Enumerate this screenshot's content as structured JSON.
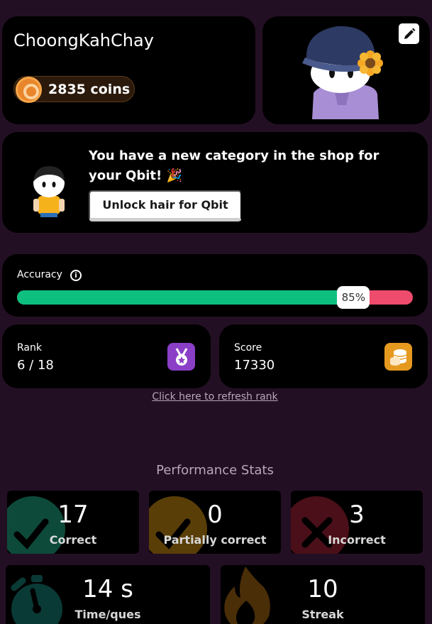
{
  "profile": {
    "username": "ChoongKahChay",
    "coins_text": "2835 coins"
  },
  "banner": {
    "message": "You have a new category in the shop for your Qbit! 🎉",
    "button_label": "Unlock hair for Qbit"
  },
  "accuracy": {
    "label": "Accuracy",
    "percent": 85,
    "percent_text": "85%",
    "colors": {
      "fill": "#0ec07f",
      "remainder": "#ef4b6c"
    }
  },
  "rank": {
    "label": "Rank",
    "value": "6 / 18"
  },
  "score": {
    "label": "Score",
    "value": "17330"
  },
  "refresh_link": "Click here to refresh rank",
  "performance": {
    "title": "Performance Stats",
    "correct": {
      "value": "17",
      "label": "Correct"
    },
    "partial": {
      "value": "0",
      "label": "Partially correct"
    },
    "incorrect": {
      "value": "3",
      "label": "Incorrect"
    },
    "time": {
      "value": "14 s",
      "label": "Time/ques"
    },
    "streak": {
      "value": "10",
      "label": "Streak"
    }
  },
  "icons": {
    "coin": "coin-icon",
    "edit": "pencil-icon",
    "info": "info-icon",
    "rank": "medal-icon",
    "score": "coin-stack-icon",
    "correct": "check-icon",
    "partial": "check-icon",
    "incorrect": "cross-icon",
    "time": "stopwatch-icon",
    "streak": "flame-icon"
  }
}
